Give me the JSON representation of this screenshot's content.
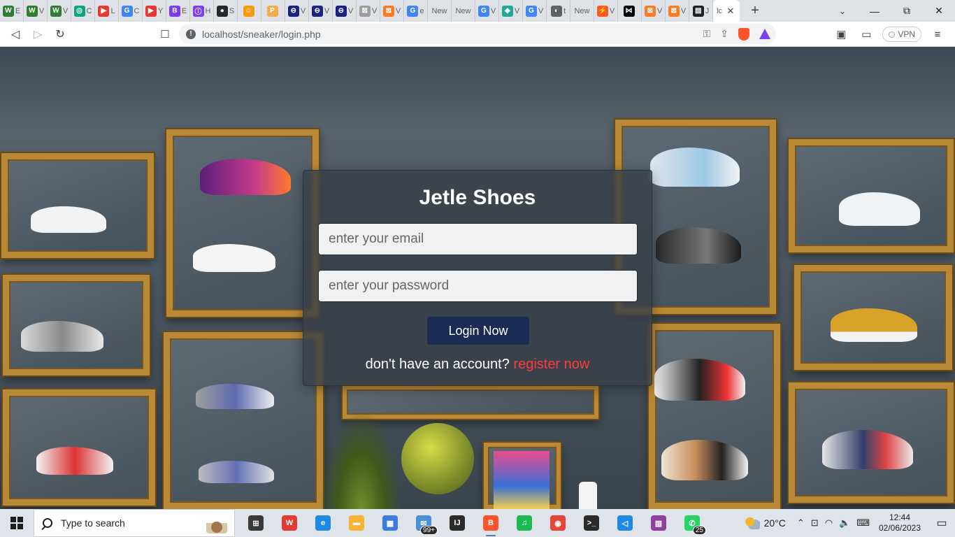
{
  "browser": {
    "tabs": [
      {
        "icon": "w-icon",
        "glyph": "W",
        "color": "#2e7d32",
        "text": "E"
      },
      {
        "icon": "w-icon",
        "glyph": "W",
        "color": "#2e7d32",
        "text": "V"
      },
      {
        "icon": "w-icon",
        "glyph": "W",
        "color": "#2e7d32",
        "text": "V"
      },
      {
        "icon": "chatgpt-icon",
        "glyph": "◎",
        "color": "#10a37f",
        "text": "C"
      },
      {
        "icon": "youtube-icon",
        "glyph": "▶",
        "color": "#e53935",
        "text": "L"
      },
      {
        "icon": "google-icon",
        "glyph": "G",
        "color": "#4285f4",
        "text": "C"
      },
      {
        "icon": "youtube-icon",
        "glyph": "▶",
        "color": "#e53935",
        "text": "Y"
      },
      {
        "icon": "bootstrap-icon",
        "glyph": "B",
        "color": "#7c3aed",
        "text": "E"
      },
      {
        "icon": "onion-icon",
        "glyph": "ⓘ",
        "color": "#7e3ff2",
        "text": "H"
      },
      {
        "icon": "github-icon",
        "glyph": "●",
        "color": "#24292f",
        "text": "S"
      },
      {
        "icon": "mascot-icon",
        "glyph": "☺",
        "color": "#f39c12",
        "text": ""
      },
      {
        "icon": "pma-icon",
        "glyph": "P",
        "color": "#f0ad4e",
        "text": ""
      },
      {
        "icon": "canva-icon",
        "glyph": "⊖",
        "color": "#1a237e",
        "text": "V"
      },
      {
        "icon": "canva-icon",
        "glyph": "⊖",
        "color": "#1a237e",
        "text": "V"
      },
      {
        "icon": "canva-icon",
        "glyph": "⊖",
        "color": "#1a237e",
        "text": "V"
      },
      {
        "icon": "xampp-icon",
        "glyph": "⊠",
        "color": "#9e9e9e",
        "text": "V"
      },
      {
        "icon": "xampp-icon",
        "glyph": "⊠",
        "color": "#fb7a24",
        "text": "V"
      },
      {
        "icon": "google-icon",
        "glyph": "G",
        "color": "#4285f4",
        "text": "e"
      },
      {
        "icon": "",
        "glyph": "",
        "color": "",
        "text": "New"
      },
      {
        "icon": "",
        "glyph": "",
        "color": "",
        "text": "New"
      },
      {
        "icon": "google-icon",
        "glyph": "G",
        "color": "#4285f4",
        "text": "V"
      },
      {
        "icon": "edge-icon",
        "glyph": "◈",
        "color": "#26a69a",
        "text": "V"
      },
      {
        "icon": "google-icon",
        "glyph": "G",
        "color": "#4285f4",
        "text": "V"
      },
      {
        "icon": "globe-icon",
        "glyph": "◐",
        "color": "#5f6368",
        "text": "t"
      },
      {
        "icon": "",
        "glyph": "",
        "color": "",
        "text": "New"
      },
      {
        "icon": "hackerrank-icon",
        "glyph": "⚡",
        "color": "#ff5722",
        "text": "V"
      },
      {
        "icon": "bowtie-icon",
        "glyph": "⋈",
        "color": "#000000",
        "text": ""
      },
      {
        "icon": "xampp-icon",
        "glyph": "⊠",
        "color": "#fb7a24",
        "text": "V"
      },
      {
        "icon": "xampp-icon",
        "glyph": "⊠",
        "color": "#fb7a24",
        "text": "V"
      },
      {
        "icon": "note-icon",
        "glyph": "▤",
        "color": "#202124",
        "text": "J"
      }
    ],
    "active_tab_title": "lc",
    "active_tab_close": "✕",
    "new_tab": "+",
    "tab_search": "⌄",
    "window_controls": {
      "minimize": "—",
      "restore": "⧉",
      "close": "✕"
    },
    "nav": {
      "back": "◁",
      "forward": "▷",
      "reload": "↻",
      "bookmark": "☐"
    },
    "address_bar": {
      "info": "!",
      "url": "localhost/sneaker/login.php",
      "key_icon": "⚿",
      "share_icon": "⇪"
    },
    "toolbar_right": {
      "sidebar_icon": "▣",
      "wallet_icon": "▭",
      "vpn_label": "VPN",
      "menu_icon": "≡"
    }
  },
  "page": {
    "title": "Jetle Shoes",
    "email": {
      "placeholder": "enter your email",
      "value": ""
    },
    "password": {
      "placeholder": "enter your password",
      "value": ""
    },
    "login_button": "Login Now",
    "register_prompt": "don't have an account?",
    "register_link": "register now"
  },
  "taskbar": {
    "search_text": "Type to search",
    "apps": [
      {
        "name": "task-view-icon",
        "glyph": "⊞",
        "color": "#3a3a3a",
        "badge": ""
      },
      {
        "name": "wps-icon",
        "glyph": "W",
        "color": "#e53935",
        "badge": ""
      },
      {
        "name": "edge-icon",
        "glyph": "e",
        "color": "#1e88e5",
        "badge": ""
      },
      {
        "name": "file-explorer-icon",
        "glyph": "▬",
        "color": "#f9b233",
        "badge": ""
      },
      {
        "name": "store-icon",
        "glyph": "▦",
        "color": "#3d7be0",
        "badge": ""
      },
      {
        "name": "mail-icon",
        "glyph": "✉",
        "color": "#4a90d9",
        "badge": "99+"
      },
      {
        "name": "intellij-icon",
        "glyph": "IJ",
        "color": "#2b2b2b",
        "badge": ""
      },
      {
        "name": "brave-icon",
        "glyph": "B",
        "color": "#fb542b",
        "badge": ""
      },
      {
        "name": "spotify-icon",
        "glyph": "♫",
        "color": "#1db954",
        "badge": ""
      },
      {
        "name": "chrome-icon",
        "glyph": "◉",
        "color": "#e8453c",
        "badge": ""
      },
      {
        "name": "terminal-icon",
        "glyph": ">_",
        "color": "#2b2b2b",
        "badge": ""
      },
      {
        "name": "vscode-icon",
        "glyph": "◁",
        "color": "#1e88e5",
        "badge": ""
      },
      {
        "name": "winrar-icon",
        "glyph": "▥",
        "color": "#8e3fa0",
        "badge": ""
      },
      {
        "name": "whatsapp-icon",
        "glyph": "✆",
        "color": "#25d366",
        "badge": "25"
      }
    ],
    "weather": {
      "temp": "20°C"
    },
    "tray": {
      "chevron": "⌃",
      "battery": "⊡",
      "wifi": "◠",
      "volume": "🔈",
      "ime": "⌨"
    },
    "clock": {
      "time": "12:44",
      "date": "02/06/2023"
    },
    "notifications_icon": "▭"
  }
}
